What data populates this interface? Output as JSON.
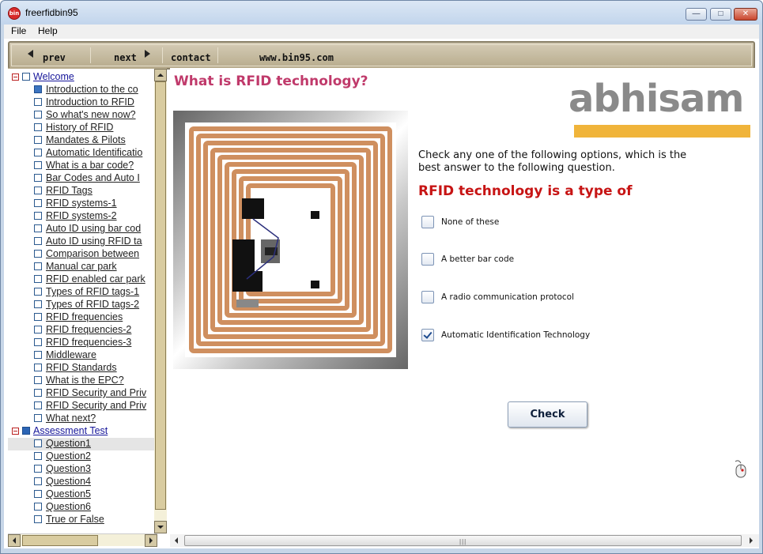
{
  "window": {
    "title": "freerfidbin95"
  },
  "menu": {
    "file": "File",
    "help": "Help"
  },
  "toolbar": {
    "prev": "prev",
    "next": "next",
    "contact": "contact",
    "website": "www.bin95.com"
  },
  "sidebar": {
    "rows": [
      {
        "label": "Welcome",
        "level": "top",
        "filled": false
      },
      {
        "label": "Introduction to the co",
        "level": "child",
        "filled": true
      },
      {
        "label": "Introduction to RFID",
        "level": "child",
        "filled": false
      },
      {
        "label": "So what's new now?",
        "level": "child",
        "filled": false
      },
      {
        "label": "History of RFID",
        "level": "child",
        "filled": false
      },
      {
        "label": "Mandates & Pilots",
        "level": "child",
        "filled": false
      },
      {
        "label": "Automatic Identificatio",
        "level": "child",
        "filled": false
      },
      {
        "label": "What is a bar code?",
        "level": "child",
        "filled": false
      },
      {
        "label": "Bar Codes and Auto I",
        "level": "child",
        "filled": false
      },
      {
        "label": "RFID Tags",
        "level": "child",
        "filled": false
      },
      {
        "label": "RFID systems-1",
        "level": "child",
        "filled": false
      },
      {
        "label": "RFID systems-2",
        "level": "child",
        "filled": false
      },
      {
        "label": "Auto ID using bar cod",
        "level": "child",
        "filled": false
      },
      {
        "label": "Auto ID using RFID ta",
        "level": "child",
        "filled": false
      },
      {
        "label": "Comparison between",
        "level": "child",
        "filled": false
      },
      {
        "label": "Manual car park",
        "level": "child",
        "filled": false
      },
      {
        "label": "RFID enabled car park",
        "level": "child",
        "filled": false
      },
      {
        "label": "Types of RFID tags-1",
        "level": "child",
        "filled": false
      },
      {
        "label": "Types of RFID tags-2",
        "level": "child",
        "filled": false
      },
      {
        "label": "RFID frequencies",
        "level": "child",
        "filled": false
      },
      {
        "label": "RFID frequencies-2",
        "level": "child",
        "filled": false
      },
      {
        "label": "RFID frequencies-3",
        "level": "child",
        "filled": false
      },
      {
        "label": "Middleware",
        "level": "child",
        "filled": false
      },
      {
        "label": "RFID Standards",
        "level": "child",
        "filled": false
      },
      {
        "label": "What is the EPC?",
        "level": "child",
        "filled": false
      },
      {
        "label": "RFID Security and Priv",
        "level": "child",
        "filled": false
      },
      {
        "label": "RFID Security and Priv",
        "level": "child",
        "filled": false
      },
      {
        "label": "What next?",
        "level": "child",
        "filled": false
      },
      {
        "label": "Assessment Test",
        "level": "top",
        "filled": true
      },
      {
        "label": "Question1",
        "level": "child",
        "filled": false,
        "selected": true
      },
      {
        "label": "Question2",
        "level": "child",
        "filled": false
      },
      {
        "label": "Question3",
        "level": "child",
        "filled": false
      },
      {
        "label": "Question4",
        "level": "child",
        "filled": false
      },
      {
        "label": "Question5",
        "level": "child",
        "filled": false
      },
      {
        "label": "Question6",
        "level": "child",
        "filled": false
      },
      {
        "label": "True or False",
        "level": "child",
        "filled": false
      }
    ]
  },
  "main": {
    "title": "What is RFID technology?",
    "logo": "abhisam",
    "intro": "Check any one of the following options, which is the best answer to the following question.",
    "question": "RFID technology is a type of",
    "options": [
      {
        "label": "None of these",
        "checked": false
      },
      {
        "label": "A better bar code",
        "checked": false
      },
      {
        "label": "A radio communication protocol",
        "checked": false
      },
      {
        "label": "Automatic Identification Technology",
        "checked": true
      }
    ],
    "check_button": "Check"
  },
  "colors": {
    "title_pink": "#c03a6b",
    "question_red": "#c71414",
    "logo_bar": "#f0b43a",
    "antenna_copper": "#cf8f5f"
  }
}
